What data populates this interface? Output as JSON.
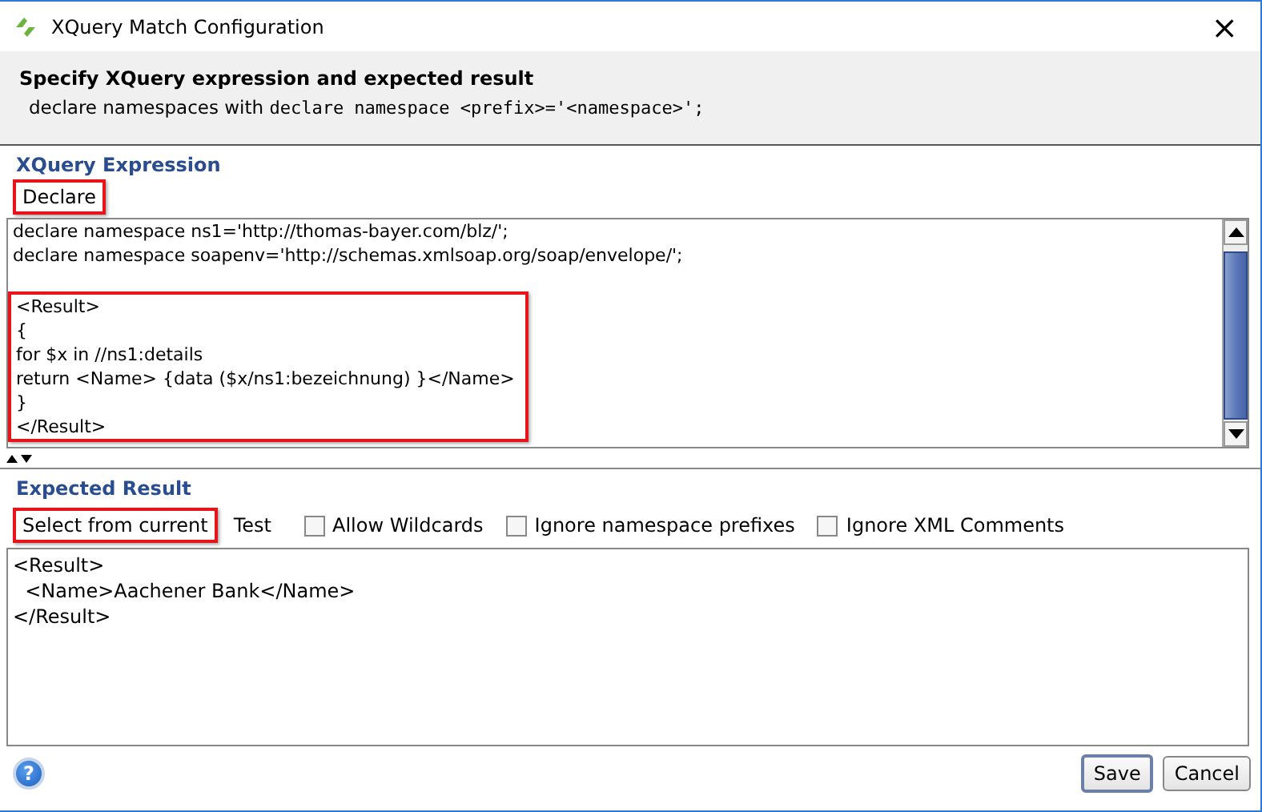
{
  "window": {
    "title": "XQuery Match Configuration",
    "close": "×"
  },
  "header": {
    "title": "Specify XQuery expression and expected result",
    "hint_prefix": "declare namespaces with ",
    "hint_code": "declare namespace <prefix>='<namespace>';"
  },
  "expression": {
    "heading": "XQuery Expression",
    "declare_button": {
      "label": "Declare",
      "highlighted": true
    },
    "lines": [
      {
        "text": "declare namespace ns1='http://thomas-bayer.com/blz/';",
        "highlighted": false
      },
      {
        "text": "declare namespace soapenv='http://schemas.xmlsoap.org/soap/envelope/';",
        "highlighted": false
      },
      {
        "text": "<Result>",
        "highlighted": true
      },
      {
        "text": "{",
        "highlighted": true
      },
      {
        "text": "for $x in //ns1:details",
        "highlighted": true
      },
      {
        "text": "return <Name> {data ($x/ns1:bezeichnung) }</Name>",
        "highlighted": true
      },
      {
        "text": "}",
        "highlighted": true
      },
      {
        "text": "</Result>",
        "highlighted": true
      }
    ]
  },
  "expected": {
    "heading": "Expected Result",
    "toolbar": [
      {
        "kind": "button",
        "label": "Select from current",
        "highlighted": true
      },
      {
        "kind": "link",
        "label": "Test"
      },
      {
        "kind": "checkbox",
        "label": "Allow Wildcards",
        "checked": false
      },
      {
        "kind": "checkbox",
        "label": "Ignore namespace prefixes",
        "checked": false
      },
      {
        "kind": "checkbox",
        "label": "Ignore XML Comments",
        "checked": false
      }
    ],
    "lines": [
      "<Result>",
      "  <Name>Aachener Bank</Name>",
      "</Result>"
    ]
  },
  "footer": {
    "help": "?",
    "buttons": [
      {
        "label": "Save",
        "default": true
      },
      {
        "label": "Cancel",
        "default": false
      }
    ]
  }
}
